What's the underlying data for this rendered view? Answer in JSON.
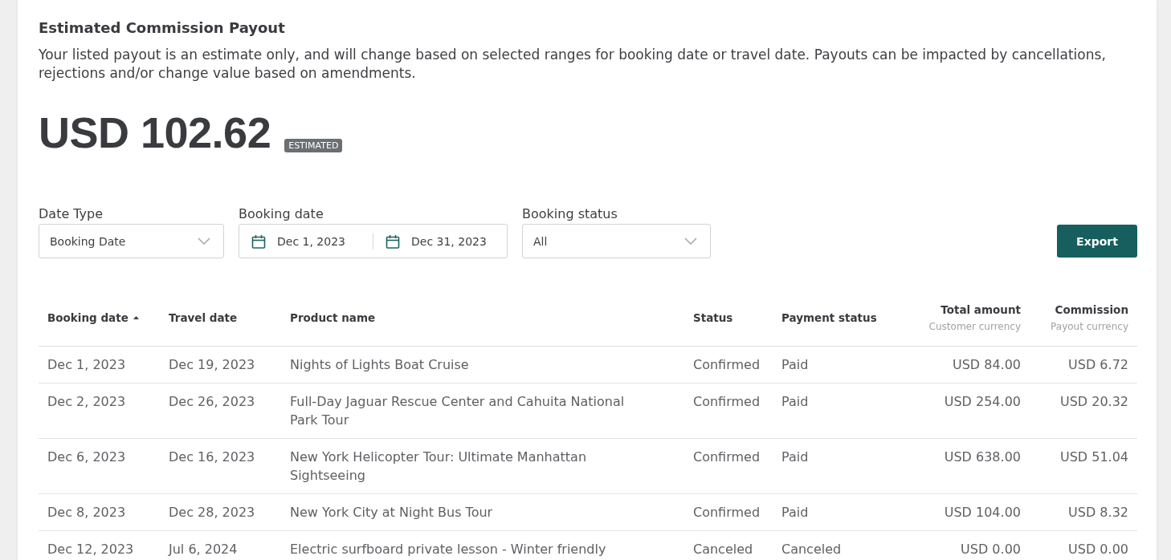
{
  "header": {
    "title": "Estimated Commission Payout",
    "description": "Your listed payout is an estimate only, and will change based on selected ranges for booking date or travel date. Payouts can be impacted by cancellations, rejections and/or change value based on amendments."
  },
  "payout": {
    "amount": "USD 102.62",
    "badge": "ESTIMATED"
  },
  "filters": [
    {
      "kind": "select",
      "label": "Date Type",
      "value": "Booking Date"
    },
    {
      "kind": "date_range",
      "label": "Booking date",
      "start": "Dec 1, 2023",
      "end": "Dec 31, 2023"
    },
    {
      "kind": "select",
      "label": "Booking status",
      "value": "All"
    }
  ],
  "export_button": {
    "label": "Export"
  },
  "table": {
    "columns": [
      {
        "label": "Booking date",
        "sorted": true,
        "kind": "text"
      },
      {
        "label": "Travel date",
        "sorted": false,
        "kind": "text"
      },
      {
        "label": "Product name",
        "sorted": false,
        "kind": "text"
      },
      {
        "label": "Status",
        "sorted": false,
        "kind": "text"
      },
      {
        "label": "Payment status",
        "sorted": false,
        "kind": "text"
      },
      {
        "label": "Total amount",
        "sublabel": "Customer currency",
        "sorted": false,
        "kind": "amount"
      },
      {
        "label": "Commission",
        "sublabel": "Payout currency",
        "sorted": false,
        "kind": "amount"
      }
    ],
    "rows": [
      [
        "Dec 1, 2023",
        "Dec 19, 2023",
        "Nights of Lights Boat Cruise",
        "Confirmed",
        "Paid",
        "USD 84.00",
        "USD 6.72"
      ],
      [
        "Dec 2, 2023",
        "Dec 26, 2023",
        "Full-Day Jaguar Rescue Center and Cahuita National Park Tour",
        "Confirmed",
        "Paid",
        "USD 254.00",
        "USD 20.32"
      ],
      [
        "Dec 6, 2023",
        "Dec 16, 2023",
        "New York Helicopter Tour: Ultimate Manhattan Sightseeing",
        "Confirmed",
        "Paid",
        "USD 638.00",
        "USD 51.04"
      ],
      [
        "Dec 8, 2023",
        "Dec 28, 2023",
        "New York City at Night Bus Tour",
        "Confirmed",
        "Paid",
        "USD 104.00",
        "USD 8.32"
      ],
      [
        "Dec 12, 2023",
        "Jul 6, 2024",
        "Electric surfboard private lesson - Winter friendly",
        "Canceled",
        "Canceled",
        "USD 0.00",
        "USD 0.00"
      ]
    ]
  }
}
